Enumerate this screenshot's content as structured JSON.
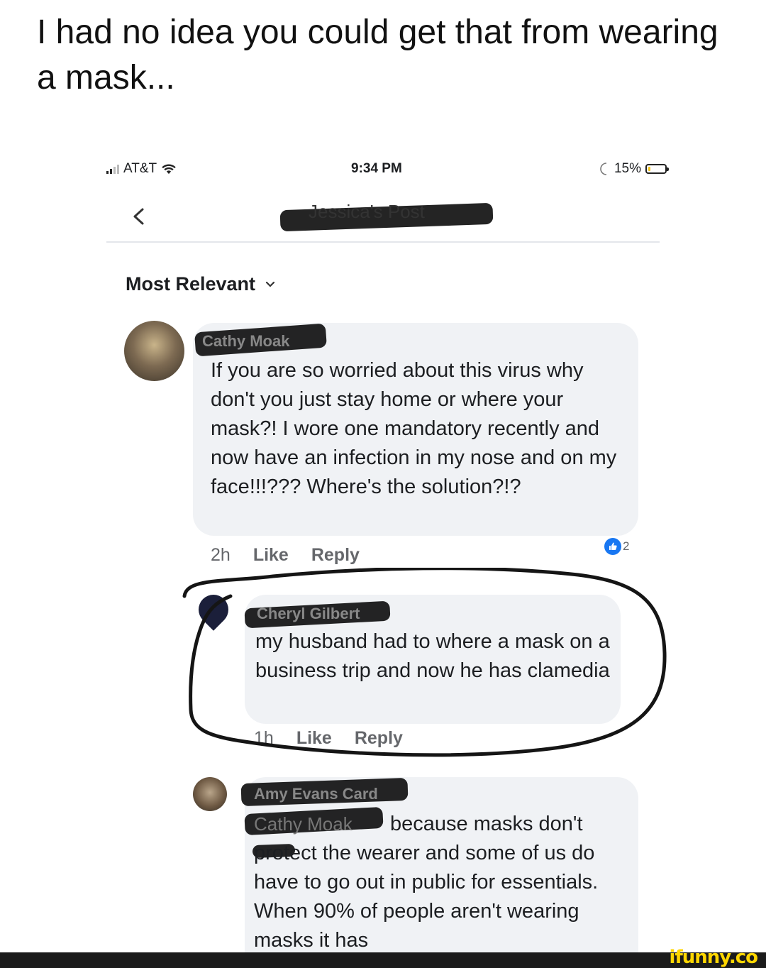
{
  "caption": "I had no idea you could get that from wearing a mask...",
  "status_bar": {
    "carrier": "AT&T",
    "time": "9:34 PM",
    "battery": "15%",
    "battery_level": 0.15
  },
  "nav": {
    "title": "Jessica's Post"
  },
  "sort": {
    "label": "Most Relevant"
  },
  "comments": [
    {
      "author": "Cathy Moak",
      "text": "If you are so worried about this virus why don't you just stay home or where your mask?! I wore one mandatory recently and now have an infection in my nose and on my face!!!??? Where's the solution?!?",
      "time": "2h",
      "like": "Like",
      "reply": "Reply",
      "reactions": "2"
    },
    {
      "author": "Cheryl Gilbert",
      "text": "my husband had to where a mask on a business trip and now he has clamedia",
      "time": "1h",
      "like": "Like",
      "reply": "Reply"
    },
    {
      "author": "Amy Evans Card",
      "mention": "Cathy Moak",
      "text": "because masks don't protect the wearer and some of us do have to go out in public for essentials. When 90% of people aren't wearing masks it has"
    }
  ],
  "watermark": "ifunny.co",
  "colors": {
    "bubble": "#f0f2f5",
    "accent": "#1877f2",
    "watermark": "#ffd600"
  }
}
